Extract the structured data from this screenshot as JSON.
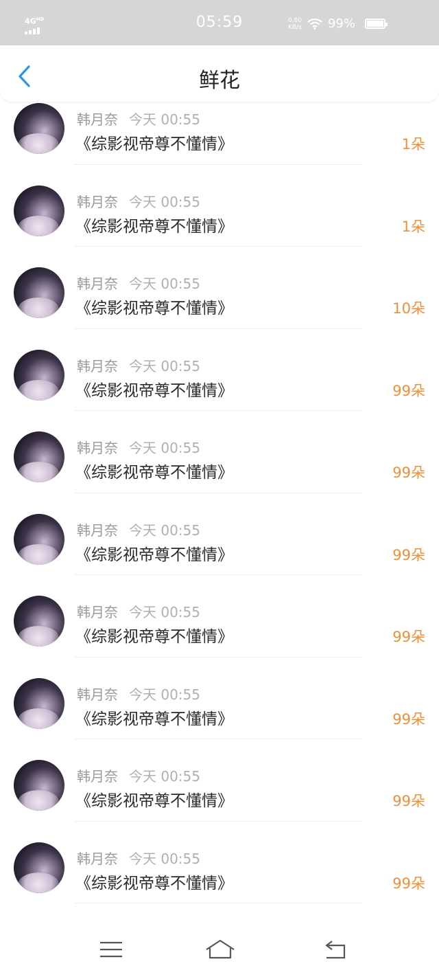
{
  "status_bar": {
    "network": "4G",
    "network_sup": "HD",
    "time": "05:59",
    "speed_value": "0.80",
    "speed_unit": "KB/s",
    "battery": "99%"
  },
  "header": {
    "title": "鲜花"
  },
  "items": [
    {
      "name": "韩月奈",
      "time": "今天 00:55",
      "book": "《综影视帝尊不懂情》",
      "count": "1朵"
    },
    {
      "name": "韩月奈",
      "time": "今天 00:55",
      "book": "《综影视帝尊不懂情》",
      "count": "1朵"
    },
    {
      "name": "韩月奈",
      "time": "今天 00:55",
      "book": "《综影视帝尊不懂情》",
      "count": "10朵"
    },
    {
      "name": "韩月奈",
      "time": "今天 00:55",
      "book": "《综影视帝尊不懂情》",
      "count": "99朵"
    },
    {
      "name": "韩月奈",
      "time": "今天 00:55",
      "book": "《综影视帝尊不懂情》",
      "count": "99朵"
    },
    {
      "name": "韩月奈",
      "time": "今天 00:55",
      "book": "《综影视帝尊不懂情》",
      "count": "99朵"
    },
    {
      "name": "韩月奈",
      "time": "今天 00:55",
      "book": "《综影视帝尊不懂情》",
      "count": "99朵"
    },
    {
      "name": "韩月奈",
      "time": "今天 00:55",
      "book": "《综影视帝尊不懂情》",
      "count": "99朵"
    },
    {
      "name": "韩月奈",
      "time": "今天 00:55",
      "book": "《综影视帝尊不懂情》",
      "count": "99朵"
    },
    {
      "name": "韩月奈",
      "time": "今天 00:55",
      "book": "《综影视帝尊不懂情》",
      "count": "99朵"
    }
  ],
  "nav": {
    "icons": [
      "menu-icon",
      "home-icon",
      "back-icon"
    ]
  },
  "colors": {
    "accent_blue": "#2a96e6",
    "count_orange": "#f08f38",
    "status_bar_bg": "#d6d6d6"
  }
}
